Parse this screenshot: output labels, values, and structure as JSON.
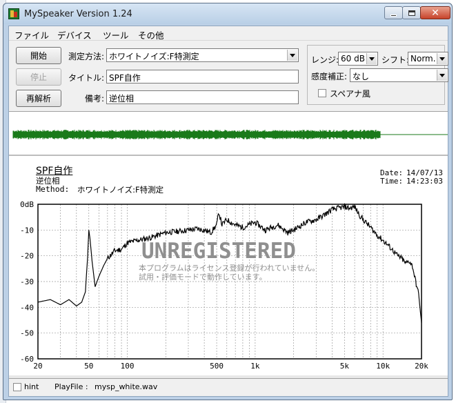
{
  "window": {
    "title": "MySpeaker Version 1.24"
  },
  "menu": [
    "ファイル",
    "デバイス",
    "ツール",
    "その他"
  ],
  "buttons": {
    "start": "開始",
    "stop": "停止",
    "reanalyze": "再解析"
  },
  "fields": {
    "method_label": "測定方法:",
    "method_value": "ホワイトノイズ:F特測定",
    "title_label": "タイトル:",
    "title_value": "SPF自作",
    "note_label": "備考:",
    "note_value": "逆位相"
  },
  "settings": {
    "range_label": "レンジ:",
    "range_value": "60 dB",
    "shift_label": "シフト:",
    "shift_value": "Norm.",
    "sens_label": "感度補正:",
    "sens_value": "なし",
    "spectrum_label": "スペアナ風",
    "spectrum_checked": false
  },
  "report": {
    "title": "SPF自作",
    "note": "逆位相",
    "method_label": "Method:",
    "method_value": "ホワイトノイズ:F特測定",
    "date_label": "Date:",
    "date_value": "14/07/13",
    "time_label": "Time:",
    "time_value": "14:23:03",
    "watermark_title": "UNREGISTERED",
    "watermark_line1": "本プログラムはライセンス登録が行われていません。",
    "watermark_line2": "試用・評価モードで動作しています。"
  },
  "status": {
    "hint_label": "hint",
    "hint_checked": false,
    "playfile_label": "PlayFile :",
    "playfile_value": "mysp_white.wav"
  },
  "colors": {
    "waveform": "#1a7a1a",
    "trace": "#000000",
    "watermark": "#8f8f8f"
  },
  "chart_data": {
    "type": "line",
    "x_scale": "log",
    "xlim": [
      20,
      20000
    ],
    "ylim": [
      -60,
      0
    ],
    "x_ticks": [
      {
        "v": 20,
        "label": "20"
      },
      {
        "v": 50,
        "label": "50"
      },
      {
        "v": 100,
        "label": "100"
      },
      {
        "v": 500,
        "label": "500"
      },
      {
        "v": 1000,
        "label": "1k"
      },
      {
        "v": 5000,
        "label": "5k"
      },
      {
        "v": 10000,
        "label": "10k"
      },
      {
        "v": 20000,
        "label": "20k"
      }
    ],
    "y_ticks": [
      {
        "v": 0,
        "label": "0dB"
      },
      {
        "v": -10,
        "label": "-10"
      },
      {
        "v": -20,
        "label": "-20"
      },
      {
        "v": -30,
        "label": "-30"
      },
      {
        "v": -40,
        "label": "-40"
      },
      {
        "v": -50,
        "label": "-50"
      },
      {
        "v": -60,
        "label": "-60"
      }
    ],
    "grid": true,
    "series": [
      {
        "x": [
          20,
          25,
          30,
          35,
          40,
          44,
          47,
          49,
          50,
          51,
          53,
          56,
          60,
          65,
          70,
          80,
          90,
          100,
          120,
          150,
          200,
          250,
          300,
          350,
          400,
          450,
          500,
          520,
          550,
          600,
          700,
          800,
          1000,
          1200,
          1500,
          1800,
          2000,
          2500,
          3000,
          3500,
          4000,
          4500,
          5000,
          5500,
          6000,
          6500,
          7000,
          8000,
          9000,
          10000,
          11000,
          12000,
          13000,
          14000,
          15000,
          16000,
          17000,
          18000,
          19000,
          20000
        ],
        "y": [
          -38,
          -37,
          -39,
          -37,
          -39.5,
          -38,
          -34,
          -20,
          -10,
          -13,
          -22,
          -32,
          -28,
          -24,
          -21,
          -18,
          -17.5,
          -15,
          -14,
          -13,
          -11,
          -10.5,
          -10,
          -9.5,
          -10,
          -11,
          -8,
          -3,
          -8,
          -6,
          -8,
          -9,
          -7,
          -10,
          -8,
          -11,
          -10,
          -7,
          -6,
          -4,
          -2,
          -1.5,
          -1,
          -1.5,
          -1,
          -4,
          -6,
          -9,
          -12,
          -14,
          -16,
          -18,
          -20,
          -21,
          -23,
          -22,
          -24,
          -30,
          -35,
          -46
        ]
      }
    ]
  }
}
